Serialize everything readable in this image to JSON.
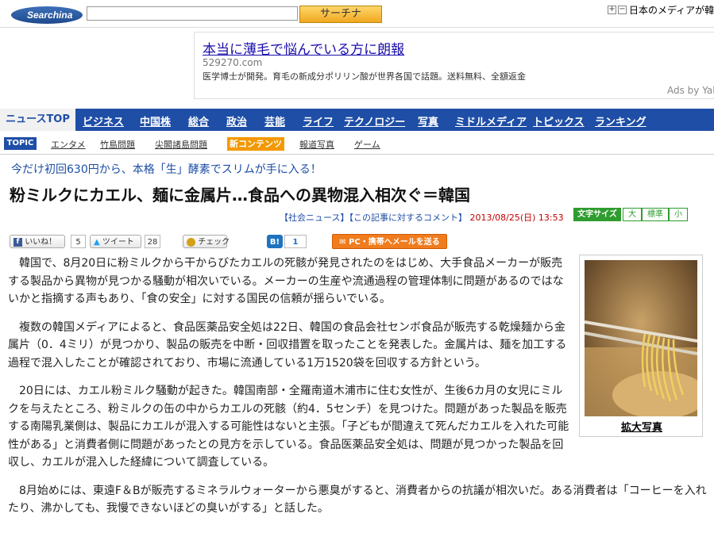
{
  "header": {
    "logo_text": "Searchina",
    "search_placeholder": "",
    "search_button": "サーチナ",
    "zoom_plus": "+",
    "zoom_minus": "−",
    "right_link": "日本のメディアが韓"
  },
  "ad": {
    "title": "本当に薄毛で悩んでいる方に朗報",
    "url": "529270.com",
    "description": "医学博士が開発。育毛の新成分ポリリン酸が世界各国で話題。送料無料、全額返金",
    "ads_by": "Ads by Yal"
  },
  "nav_main": {
    "active": "ニュースTOP",
    "items": [
      "ビジネス",
      "中国株",
      "総合",
      "政治",
      "芸能",
      "ライフ",
      "テクノロジー",
      "写真",
      "ミドルメディア",
      "トピックス",
      "ランキング"
    ]
  },
  "nav_topic": {
    "label": "TOPIC",
    "items": [
      "エンタメ",
      "竹島問題",
      "尖閣諸島問題"
    ],
    "new_label": "新コンテンツ",
    "items_after": [
      "報道写真",
      "ゲーム"
    ]
  },
  "article": {
    "promo": "今だけ初回630円から、本格「生」酵素でスリムが手に入る！",
    "headline": "粉ミルクにカエル、麺に金属片…食品への異物混入相次ぐ＝韓国",
    "meta_category": "【社会ニュース】",
    "meta_comment": "【この記事に対するコメント】",
    "meta_date": "2013/08/25(日) 13:53",
    "font_size_label": "文字サイズ",
    "font_sizes": [
      "大",
      "標準",
      "小"
    ],
    "paragraphs": [
      "韓国で、8月20日に粉ミルクから干からびたカエルの死骸が発見されたのをはじめ、大手食品メーカーが販売する製品から異物が見つかる騒動が相次いでいる。メーカーの生産や流通過程の管理体制に問題があるのではないかと指摘する声もあり、「食の安全」に対する国民の信頼が揺らいでいる。",
      "複数の韓国メディアによると、食品医薬品安全処は22日、韓国の食品会社センボ食品が販売する乾燥麺から金属片（0．4ミリ）が見つかり、製品の販売を中断・回収措置を取ったことを発表した。金属片は、麺を加工する過程で混入したことが確認されており、市場に流通している1万1520袋を回収する方針という。",
      "20日には、カエル粉ミルク騒動が起きた。韓国南部・全羅南道木浦市に住む女性が、生後6カ月の女児にミルクを与えたところ、粉ミルクの缶の中からカエルの死骸（約4．5センチ）を見つけた。問題があった製品を販売する南陽乳業側は、製品にカエルが混入する可能性はないと主張。「子どもが間違えて死んだカエルを入れた可能性がある」と消費者側に問題があったとの見方を示している。食品医薬品安全処は、問題が見つかった製品を回収し、カエルが混入した経緯について調査している。",
      "8月始めには、東遠F＆Bが販売するミネラルウォーターから悪臭がすると、消費者からの抗議が相次いだ。ある消費者は「コーヒーを入れたり、沸かしても、我慢できないほどの臭いがする」と話した。"
    ],
    "photo_caption": "拡大写真"
  },
  "share": {
    "like_label": "いいね！",
    "like_count": "5",
    "tweet_label": "ツイート",
    "tweet_count": "28",
    "check_label": "チェック",
    "hatena_label": "B!",
    "hatena_count": "1",
    "mail_label": "PC・携帯へメールを送る"
  },
  "colors": {
    "nav_blue": "#1e4ea6",
    "search_button": "#f0a820",
    "new_badge": "#f39800",
    "font_size_green": "#2e9c2e",
    "mail_orange": "#f07c1e",
    "date_red": "#c00000"
  }
}
